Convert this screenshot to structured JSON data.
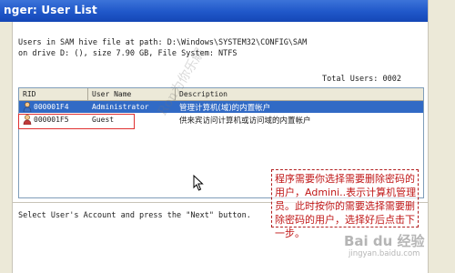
{
  "window": {
    "title": "nger: User List"
  },
  "info": {
    "line1": "Users in SAM hive file at path: D:\\Windows\\SYSTEM32\\CONFIG\\SAM",
    "line2": "on drive D: (), size 7.90 GB, File System: NTFS",
    "total_users": "Total Users: 0002"
  },
  "table": {
    "columns": [
      "RID",
      "User Name",
      "Description"
    ],
    "rows": [
      {
        "rid": "000001F4",
        "user": "Administrator",
        "desc": "管理计算机(域)的内置帐户",
        "selected": true
      },
      {
        "rid": "000001F5",
        "user": "Guest",
        "desc": "供来宾访问计算机或访问域的内置帐户",
        "selected": false
      }
    ]
  },
  "instruction": "Select User's Account and press the \"Next\" button.",
  "annotation": {
    "text": "程序需要你选择需要删除密码的用户，Admini..表示计算机管理员。此时按你的需要选择需要删除密码的用户，选择好后点击下一步。",
    "color": "#c01818"
  },
  "watermarks": {
    "diagonal": "Ron为你乐解",
    "brand": "Bai du 经验",
    "url": "jingyan.baidu.com"
  },
  "icons": {
    "user": "user-icon",
    "cursor": "mouse-pointer-icon"
  },
  "colors": {
    "titlebar": "#1f57c9",
    "selection": "#316ac5",
    "highlight_box": "#e03030"
  }
}
